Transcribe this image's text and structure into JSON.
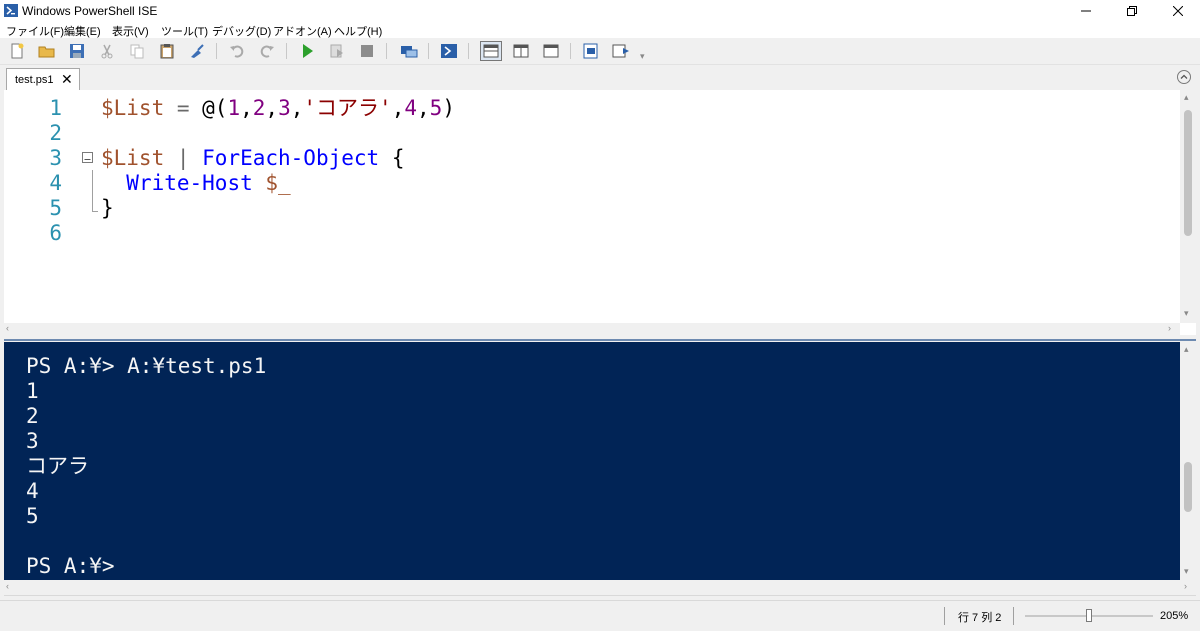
{
  "window": {
    "title": "Windows PowerShell ISE"
  },
  "menu": [
    "ファイル(F)",
    "編集(E)",
    "表示(V)",
    "ツール(T)",
    "デバッグ(D)",
    "アドオン(A)",
    "ヘルプ(H)"
  ],
  "toolbar": {
    "icons": [
      "new-file-icon",
      "open-folder-icon",
      "save-icon",
      "cut-icon",
      "copy-icon",
      "paste-icon",
      "clear-console-icon",
      "undo-icon",
      "redo-icon",
      "run-script-icon",
      "run-selection-icon",
      "stop-icon",
      "new-remote-tab-icon",
      "powershell-icon",
      "layout-top-icon",
      "layout-right-icon",
      "layout-max-icon",
      "show-script-pane-icon",
      "show-commands-icon"
    ]
  },
  "tabs": [
    {
      "label": "test.ps1",
      "close": "✕"
    }
  ],
  "editor": {
    "line_numbers": [
      "1",
      "2",
      "3",
      "4",
      "5",
      "6"
    ],
    "lines": [
      [
        {
          "t": "$List",
          "k": "var"
        },
        {
          "t": " = ",
          "k": "op"
        },
        {
          "t": "@(",
          "k": "plain"
        },
        {
          "t": "1",
          "k": "num"
        },
        {
          "t": ",",
          "k": "plain"
        },
        {
          "t": "2",
          "k": "num"
        },
        {
          "t": ",",
          "k": "plain"
        },
        {
          "t": "3",
          "k": "num"
        },
        {
          "t": ",",
          "k": "plain"
        },
        {
          "t": "'コアラ'",
          "k": "str"
        },
        {
          "t": ",",
          "k": "plain"
        },
        {
          "t": "4",
          "k": "num"
        },
        {
          "t": ",",
          "k": "plain"
        },
        {
          "t": "5",
          "k": "num"
        },
        {
          "t": ")",
          "k": "plain"
        }
      ],
      [],
      [
        {
          "t": "$List",
          "k": "var"
        },
        {
          "t": " | ",
          "k": "op"
        },
        {
          "t": "ForEach-Object",
          "k": "cmd"
        },
        {
          "t": " {",
          "k": "plain"
        }
      ],
      [
        {
          "t": "  ",
          "k": "plain"
        },
        {
          "t": "Write-Host",
          "k": "cmd"
        },
        {
          "t": " ",
          "k": "plain"
        },
        {
          "t": "$_",
          "k": "var"
        }
      ],
      [
        {
          "t": "}",
          "k": "plain"
        }
      ],
      []
    ]
  },
  "console": {
    "lines": [
      "PS A:¥> A:¥test.ps1",
      "1",
      "2",
      "3",
      "コアラ",
      "4",
      "5",
      "",
      "PS A:¥>"
    ]
  },
  "status": {
    "position": "行 7  列 2",
    "zoom_label": "205%",
    "zoom_fraction": 0.5
  },
  "colors": {
    "console_bg": "#012456",
    "variable": "#a0522d",
    "string": "#8b0000",
    "number": "#800080",
    "command": "#0000ff",
    "line_number": "#2b91af"
  }
}
